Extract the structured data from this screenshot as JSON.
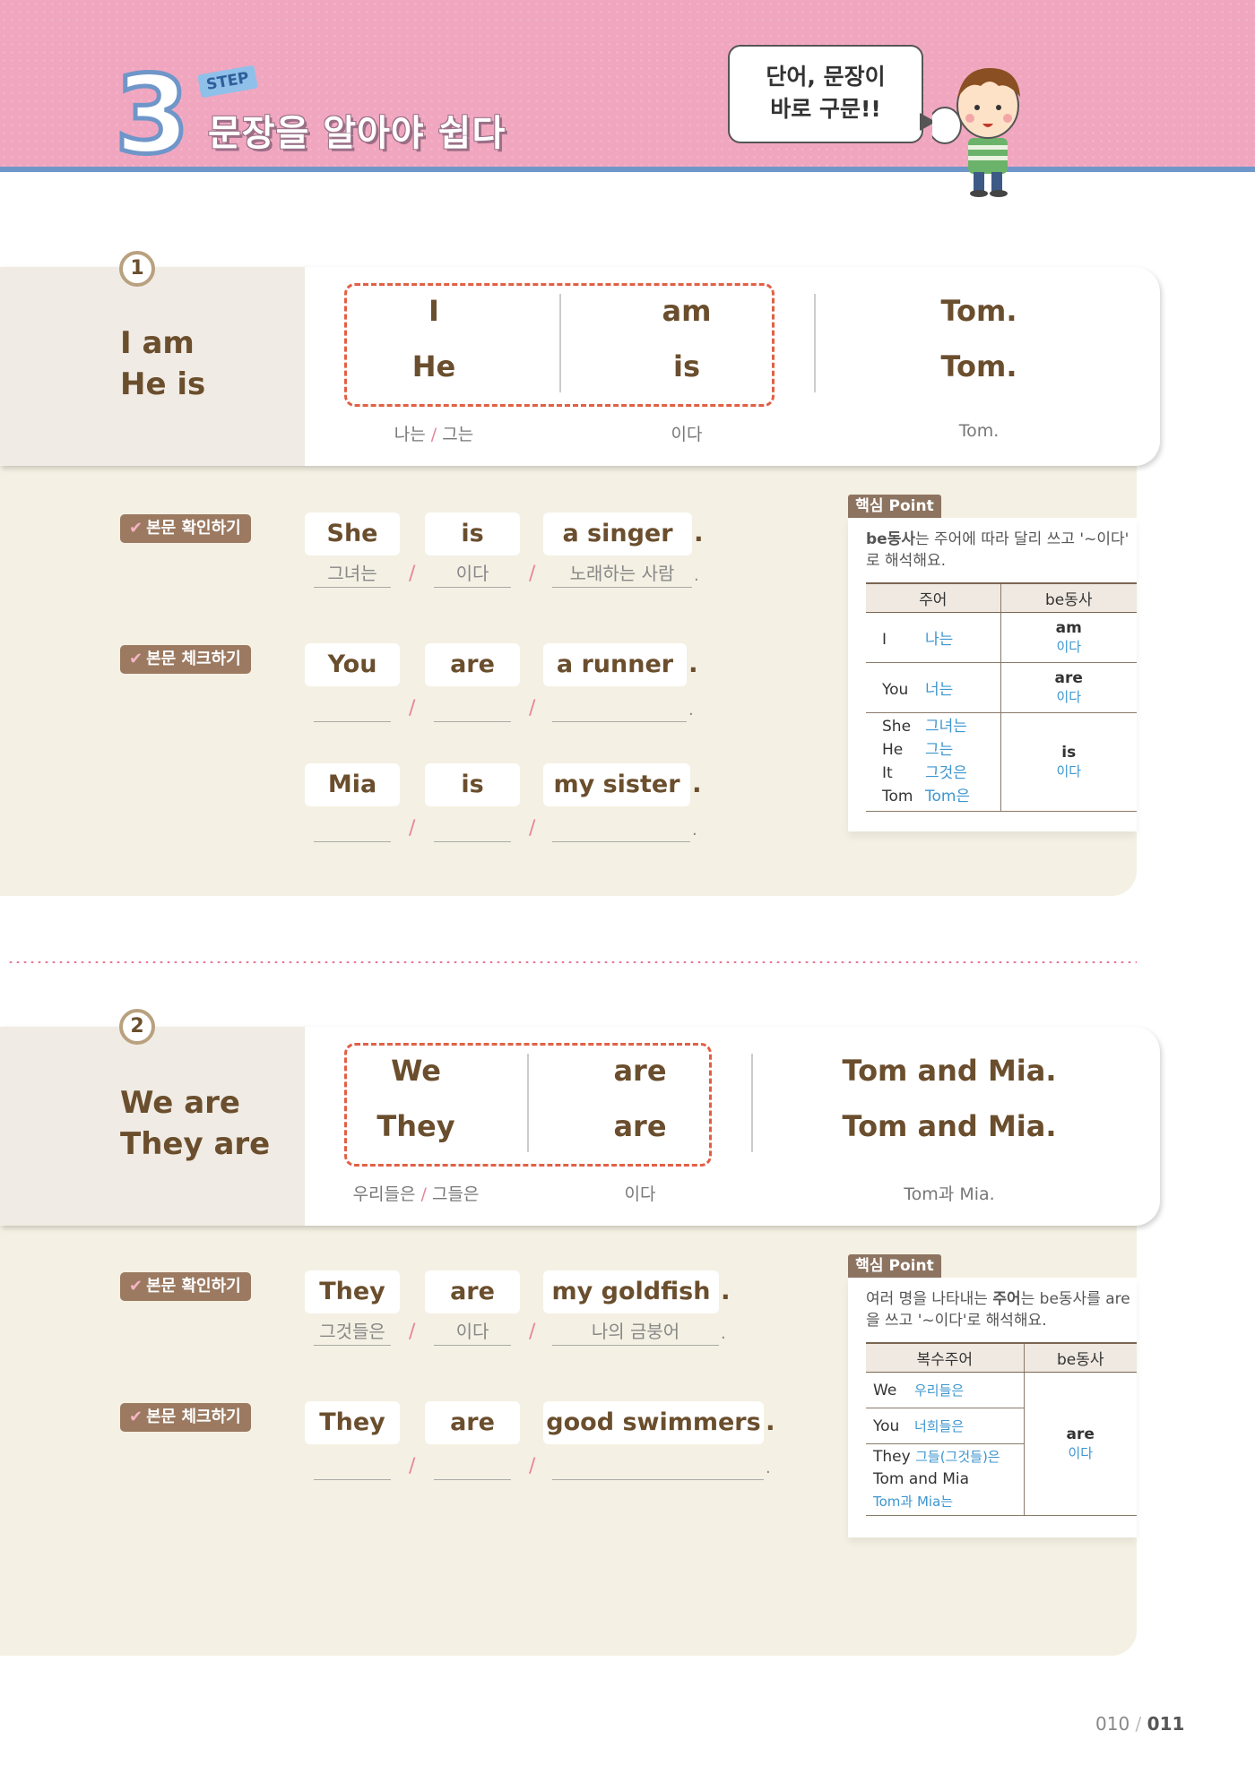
{
  "header": {
    "step_number": "3",
    "step_label": "STEP",
    "title": "문장을 알아야 쉽다",
    "bubble_line1": "단어, 문장이",
    "bubble_line2": "바로 구문!!"
  },
  "sections": [
    {
      "number": "1",
      "title_lines": [
        "I am",
        "He is"
      ],
      "pattern_rows": [
        {
          "subject": "I",
          "verb": "am",
          "complement": "Tom."
        },
        {
          "subject": "He",
          "verb": "is",
          "complement": "Tom."
        }
      ],
      "glosses": {
        "subject_a": "나는",
        "subject_b": "그는",
        "verb": "이다",
        "complement": "Tom."
      },
      "exercises": [
        {
          "badge": "본문 확인하기",
          "words": [
            "She",
            "is",
            "a singer"
          ],
          "answers": [
            "그녀는",
            "이다",
            "노래하는 사람"
          ]
        },
        {
          "badge": "본문 체크하기",
          "words": [
            "You",
            "are",
            "a runner"
          ],
          "answers": [
            "",
            "",
            ""
          ]
        },
        {
          "badge": "",
          "words": [
            "Mia",
            "is",
            "my sister"
          ],
          "answers": [
            "",
            "",
            ""
          ]
        }
      ],
      "point": {
        "tag": "핵심 Point",
        "desc_bold": "be동사",
        "desc_rest": "는 주어에 따라 달리 쓰고 '~이다'",
        "desc_line2": "로 해석해요.",
        "col1": "주어",
        "col2": "be동사",
        "rows": [
          {
            "subjects": [
              [
                "I",
                "나는"
              ]
            ],
            "verb": "am",
            "meaning": "이다"
          },
          {
            "subjects": [
              [
                "You",
                "너는"
              ]
            ],
            "verb": "are",
            "meaning": "이다"
          },
          {
            "subjects": [
              [
                "She",
                "그녀는"
              ],
              [
                "He",
                "그는"
              ],
              [
                "It",
                "그것은"
              ],
              [
                "Tom",
                "Tom은"
              ]
            ],
            "verb": "is",
            "meaning": "이다"
          }
        ]
      }
    },
    {
      "number": "2",
      "title_lines": [
        "We are",
        "They are"
      ],
      "pattern_rows": [
        {
          "subject": "We",
          "verb": "are",
          "complement": "Tom and Mia."
        },
        {
          "subject": "They",
          "verb": "are",
          "complement": "Tom and Mia."
        }
      ],
      "glosses": {
        "subject_a": "우리들은",
        "subject_b": "그들은",
        "verb": "이다",
        "complement": "Tom과 Mia."
      },
      "exercises": [
        {
          "badge": "본문 확인하기",
          "words": [
            "They",
            "are",
            "my goldfish"
          ],
          "answers": [
            "그것들은",
            "이다",
            "나의 금붕어"
          ]
        },
        {
          "badge": "본문 체크하기",
          "words": [
            "They",
            "are",
            "good swimmers"
          ],
          "answers": [
            "",
            "",
            ""
          ]
        }
      ],
      "point": {
        "tag": "핵심 Point",
        "desc_pre": "여러 명을 나타내는 ",
        "desc_bold": "주어",
        "desc_rest": "는 be동사를 are",
        "desc_line2": "을 쓰고 '~이다'로 해석해요.",
        "col1": "복수주어",
        "col2": "be동사",
        "rows": [
          {
            "subject": "We",
            "meaning": "우리들은"
          },
          {
            "subject": "You",
            "meaning": "너희들은"
          },
          {
            "subject": "They",
            "meaning": "그들(그것들)은",
            "extra": "Tom and Mia",
            "extra_meaning": "Tom과 Mia는"
          }
        ],
        "verb": "are",
        "verb_meaning": "이다"
      }
    }
  ],
  "page_numbers": {
    "left": "010",
    "sep": "/",
    "right": "011"
  }
}
